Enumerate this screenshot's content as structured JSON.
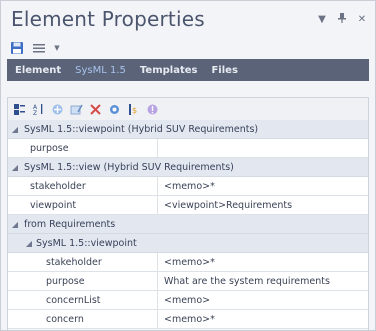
{
  "window": {
    "title": "Element Properties",
    "controls": [
      "pin-icon",
      "dock-icon",
      "close-icon"
    ]
  },
  "toolbar": {
    "icons": [
      "save-icon",
      "menu-icon",
      "dropdown-icon"
    ]
  },
  "tabs": [
    {
      "label": "Element",
      "active": false
    },
    {
      "label": "SysML 1.5",
      "active": true
    },
    {
      "label": "Templates",
      "active": false
    },
    {
      "label": "Files",
      "active": false
    }
  ],
  "grid_toolbar": {
    "icons": [
      "categorized-icon",
      "sort-az-icon",
      "add-icon",
      "edit-icon",
      "delete-icon",
      "refresh-icon",
      "filter-icon",
      "help-icon"
    ]
  },
  "sections": [
    {
      "title": "SysML 1.5::viewpoint (Hybrid SUV Requirements)",
      "rows": [
        {
          "name": "purpose",
          "value": ""
        }
      ]
    },
    {
      "title": "SysML 1.5::view (Hybrid SUV Requirements)",
      "rows": [
        {
          "name": "stakeholder",
          "value": "<memo>*"
        },
        {
          "name": "viewpoint",
          "value": "<viewpoint>Requirements"
        }
      ]
    },
    {
      "title": "from Requirements",
      "subsection": {
        "title": "SysML 1.5::viewpoint",
        "rows": [
          {
            "name": "stakeholder",
            "value": "<memo>*"
          },
          {
            "name": "purpose",
            "value": "What are the system requirements"
          },
          {
            "name": "concernList",
            "value": "<memo>"
          },
          {
            "name": "concern",
            "value": "<memo>*"
          }
        ]
      }
    }
  ],
  "colors": {
    "tab_bar": "#5a6377",
    "group_bg": "#e3e8f0",
    "title": "#4b556d"
  }
}
